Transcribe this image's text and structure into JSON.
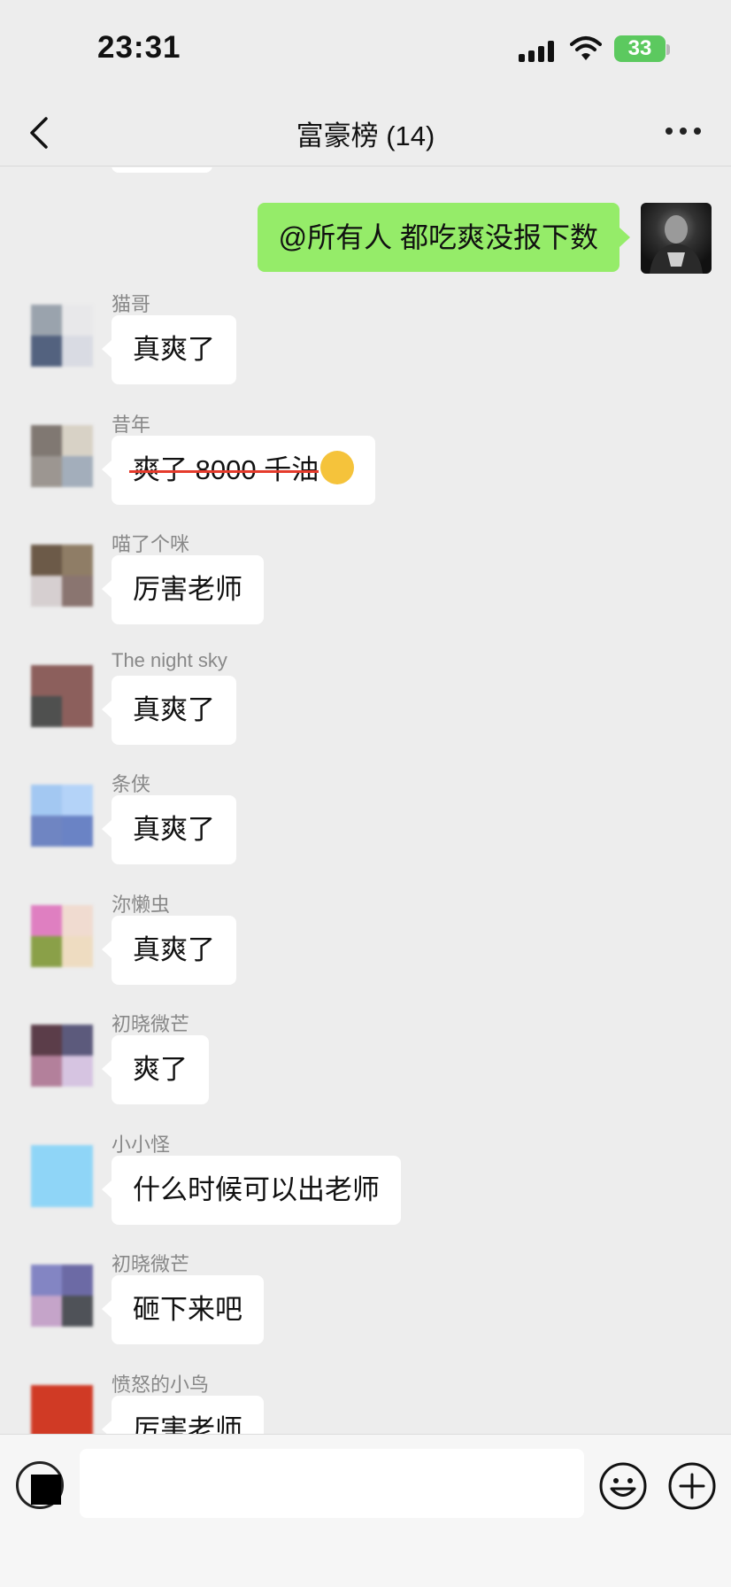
{
  "status_bar": {
    "time": "23:31",
    "battery": "33"
  },
  "header": {
    "title": "富豪榜 (14)"
  },
  "outgoing": {
    "text": "@所有人 都吃爽没报下数"
  },
  "messages": [
    {
      "sender": "猫哥",
      "text": "真爽了",
      "avatar_colors": [
        "#9aa3ad",
        "#e8e8ea",
        "#53627f",
        "#d9dbe3"
      ]
    },
    {
      "sender": "昔年",
      "text": "爽了 8000 千油",
      "strikethrough": true,
      "emoji": "hugging-face",
      "avatar_colors": [
        "#807872",
        "#d8d2c6",
        "#9c9691",
        "#a3aebb"
      ]
    },
    {
      "sender": "喵了个咪",
      "text": "厉害老师",
      "avatar_colors": [
        "#6c5a48",
        "#8f7d66",
        "#d6cfd0",
        "#8a7570"
      ]
    },
    {
      "sender": "The night sky",
      "text": "真爽了",
      "avatar_colors": [
        "#8c5f5c",
        "#8c5f5c",
        "#4f504f",
        "#8c5f5c"
      ]
    },
    {
      "sender": "条侠",
      "text": "真爽了",
      "avatar_colors": [
        "#a3c8f2",
        "#b4d3f8",
        "#6f85c2",
        "#6a83c5"
      ]
    },
    {
      "sender": "沵懒虫",
      "text": "真爽了",
      "avatar_colors": [
        "#df7fc1",
        "#f0dbd0",
        "#8aa048",
        "#eedcc1"
      ]
    },
    {
      "sender": "初晓微芒",
      "text": "爽了",
      "avatar_colors": [
        "#5b3d49",
        "#5c5a7c",
        "#b3809b",
        "#d6c4e1"
      ]
    },
    {
      "sender": "小小怪",
      "text": "什么时候可以出老师",
      "avatar_colors": [
        "#8fd5f7",
        "#8fd5f7",
        "#8fd5f7",
        "#8fd5f7"
      ]
    },
    {
      "sender": "初晓微芒",
      "text": "砸下来吧",
      "avatar_colors": [
        "#8385c3",
        "#6c6aa5",
        "#c5a4c9",
        "#4f5258"
      ]
    },
    {
      "sender": "愤怒的小鸟",
      "text": "厉害老师",
      "avatar_colors": [
        "#d03a25",
        "#d03a25",
        "#d03a25",
        "#d03a25"
      ]
    }
  ],
  "input": {
    "placeholder": ""
  }
}
